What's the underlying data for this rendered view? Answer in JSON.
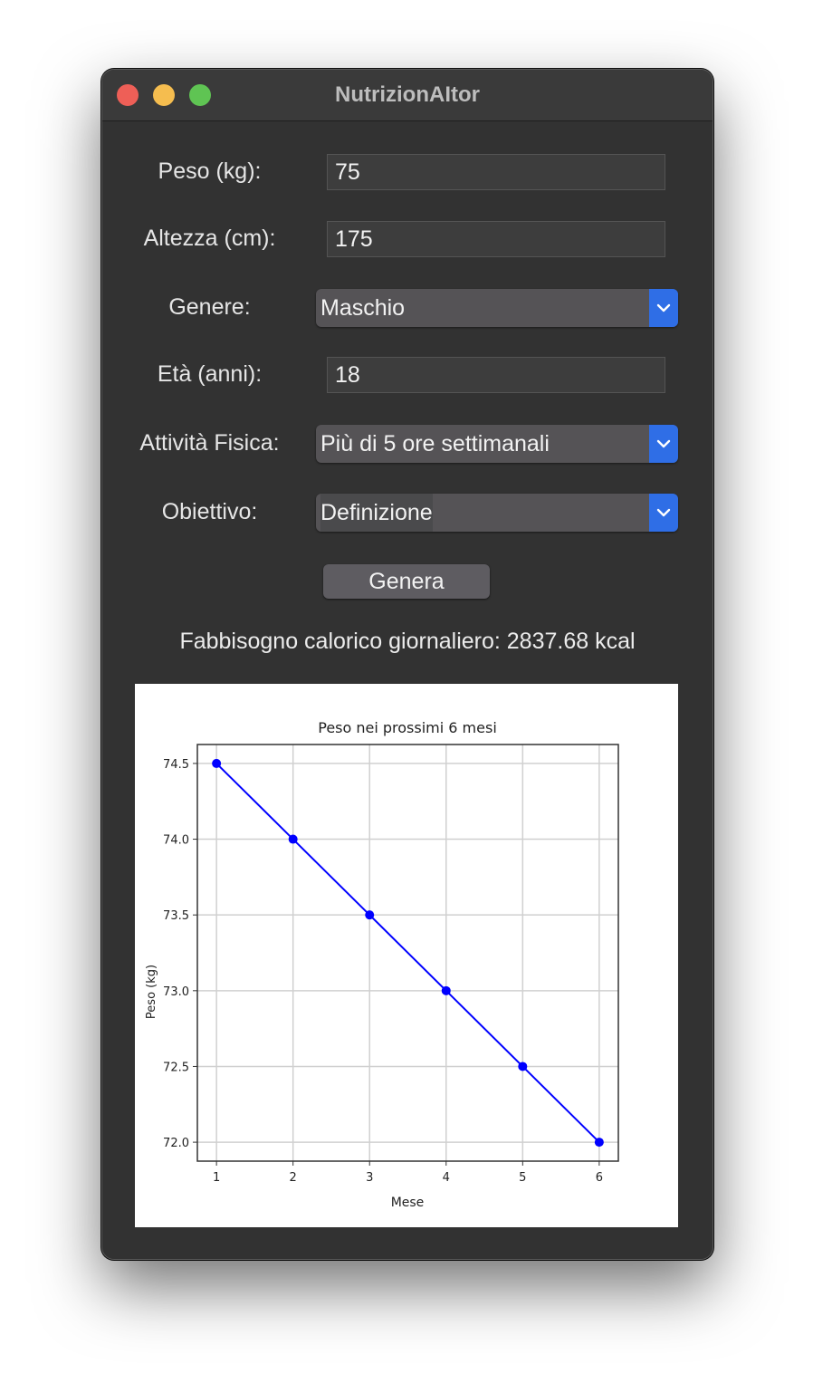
{
  "window": {
    "title": "NutrizionAItor"
  },
  "form": {
    "weight_label": "Peso (kg):",
    "weight_value": "75",
    "height_label": "Altezza (cm):",
    "height_value": "175",
    "gender_label": "Genere:",
    "gender_value": "Maschio",
    "age_label": "Età (anni):",
    "age_value": "18",
    "activity_label": "Attività Fisica:",
    "activity_value": "Più di 5 ore settimanali",
    "goal_label": "Obiettivo:",
    "goal_value": "Definizione",
    "generate_label": "Genera"
  },
  "result": {
    "text": "Fabbisogno calorico giornaliero: 2837.68 kcal"
  },
  "colors": {
    "dropdown_accent": "#2f6ee6",
    "line": "#0000ff"
  },
  "icons": {
    "dropdown": "chevron-down-icon"
  },
  "chart_data": {
    "type": "line",
    "title": "Peso nei prossimi 6 mesi",
    "xlabel": "Mese",
    "ylabel": "Peso (kg)",
    "x": [
      1,
      2,
      3,
      4,
      5,
      6
    ],
    "series": [
      {
        "values": [
          74.5,
          74.0,
          73.5,
          73.0,
          72.5,
          72.0
        ]
      }
    ],
    "xticks": [
      "1",
      "2",
      "3",
      "4",
      "5",
      "6"
    ],
    "yticks": [
      "72.0",
      "72.5",
      "73.0",
      "73.5",
      "74.0",
      "74.5"
    ],
    "xlim": [
      0.75,
      6.25
    ],
    "ylim": [
      71.875,
      74.625
    ],
    "grid": true
  }
}
